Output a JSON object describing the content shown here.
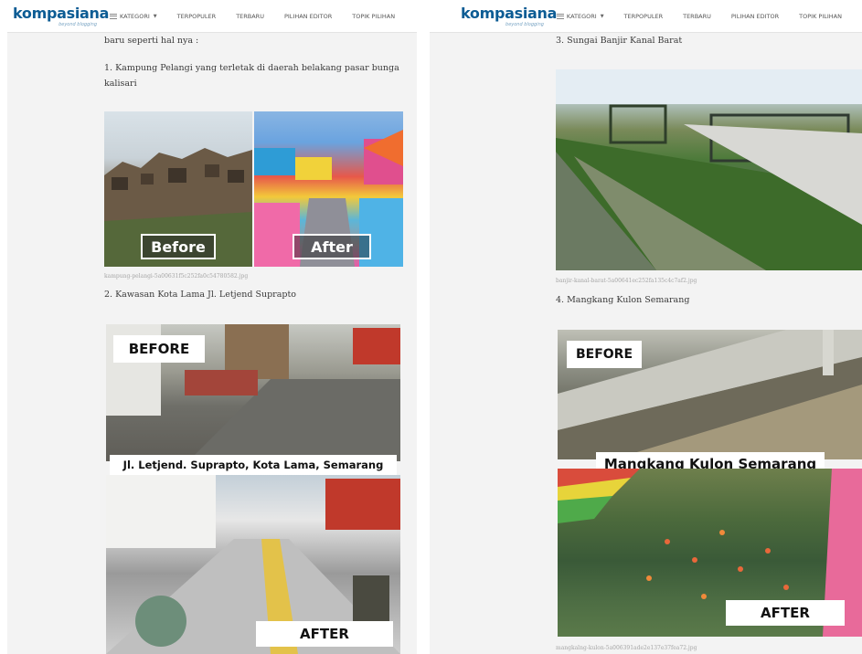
{
  "header": {
    "logo": "kompasiana",
    "tagline": "beyond blogging",
    "nav_left": [
      "KATEGORI",
      "TERPOPULER",
      "TERBARU",
      "PILIHAN EDITOR",
      "TOPIK PILIHAN"
    ],
    "nav_right": [
      "KATEGORI",
      "TERPOPULER",
      "TERBARU",
      "PILIHAN EDITOR",
      "TOPIK PILIHAN"
    ]
  },
  "left": {
    "intro": "baru seperti hal nya :",
    "item1": "1. Kampung Pelangi yang terletak di daerah belakang pasar bunga",
    "item1b": "kalisari",
    "img1_before": "Before",
    "img1_after": "After",
    "caption1": "kampung-pelangi-5a00631f5c252fa0c54780582.jpg",
    "item2": "2. Kawasan Kota Lama Jl. Letjend Suprapto",
    "img2_before": "BEFORE",
    "img2_overlay": "Jl. Letjend. Suprapto, Kota Lama, Semarang",
    "img2_after": "AFTER"
  },
  "right": {
    "item3": "3. Sungai Banjir Kanal Barat",
    "caption3": "banjir-kanal-barat-5a00641ec252fa135c4c7af2.jpg",
    "item4": "4. Mangkang Kulon Semarang",
    "img4_before": "BEFORE",
    "img4_overlay": "Mangkang Kulon Semarang",
    "img4_after": "AFTER",
    "caption4": "mangkalng-kulon-5a006391ade2e137e37fea72.jpg"
  }
}
